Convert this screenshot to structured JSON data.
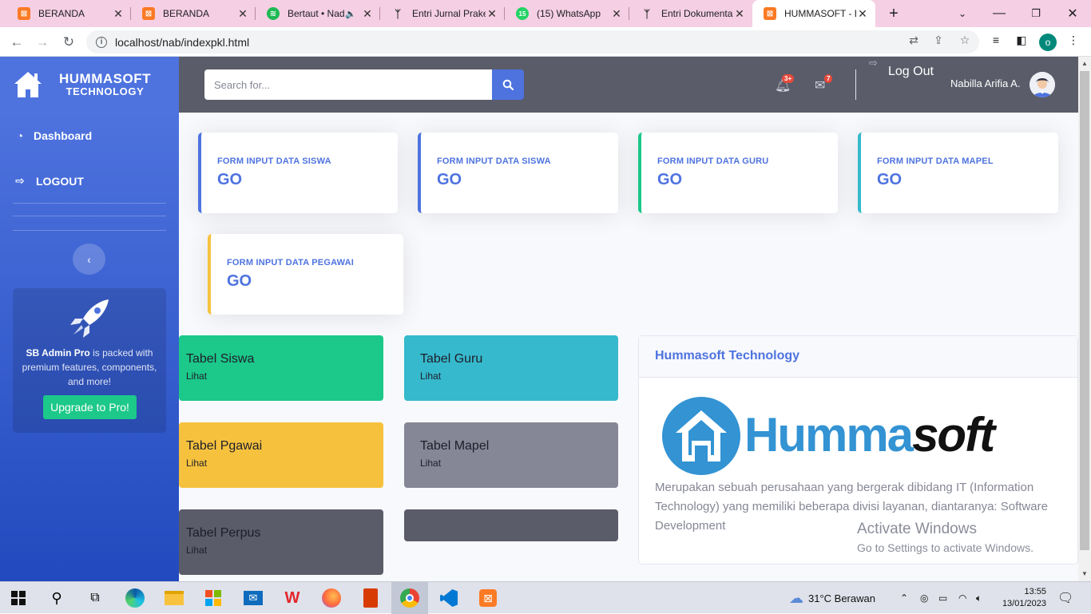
{
  "browser": {
    "tabs": [
      {
        "label": "BERANDA",
        "icon": "xampp-icon",
        "color": "#fb7a24"
      },
      {
        "label": "BERANDA",
        "icon": "xampp-icon",
        "color": "#fb7a24"
      },
      {
        "label": "Bertaut • Nad",
        "icon": "spotify-icon",
        "color": "#1db954"
      },
      {
        "label": "Entri Jurnal Prake",
        "icon": "feather-icon",
        "color": "#444"
      },
      {
        "label": "(15) WhatsApp",
        "icon": "whatsapp-icon",
        "color": "#25d366",
        "badge": "15"
      },
      {
        "label": "Entri Dokumenta",
        "icon": "feather-icon",
        "color": "#444"
      },
      {
        "label": "HUMMASOFT - D",
        "icon": "xampp-icon",
        "color": "#fb7a24"
      }
    ],
    "url": "localhost/nab/indexpkl.html",
    "profile_initial": "o"
  },
  "sidebar": {
    "brand_line1": "HUMMASOFT",
    "brand_line2": "TECHNOLOGY",
    "items": [
      {
        "label": "Dashboard",
        "icon": "tachometer-icon"
      },
      {
        "label": "LOGOUT",
        "icon": "sign-out-icon"
      }
    ],
    "promo_name": "SB Admin Pro",
    "promo_text": " is packed with premium features, components, and more!",
    "promo_button": "Upgrade to Pro!"
  },
  "topbar": {
    "search_placeholder": "Search for...",
    "alerts_badge": "3+",
    "messages_badge": "7",
    "logout_label": "Log Out",
    "username": "Nabilla Arifia A."
  },
  "cards": [
    {
      "title": "FORM INPUT DATA SISWA",
      "value": "GO",
      "accent": "#4e73df"
    },
    {
      "title": "FORM INPUT DATA SISWA",
      "value": "GO",
      "accent": "#4e73df"
    },
    {
      "title": "FORM INPUT DATA GURU",
      "value": "GO",
      "accent": "#1cc88a"
    },
    {
      "title": "FORM INPUT DATA MAPEL",
      "value": "GO",
      "accent": "#36b9cc"
    },
    {
      "title": "FORM INPUT DATA PEGAWAI",
      "value": "GO",
      "accent": "#f6c23e"
    }
  ],
  "tiles": [
    {
      "name": "Tabel Siswa",
      "sub": "Lihat",
      "color": "#1cc88a"
    },
    {
      "name": "Tabel Guru",
      "sub": "Lihat",
      "color": "#36b9cc"
    },
    {
      "name": "Tabel Pgawai",
      "sub": "Lihat",
      "color": "#f6c23e"
    },
    {
      "name": "Tabel Mapel",
      "sub": "Lihat",
      "color": "#858796"
    },
    {
      "name": "Tabel Perpus",
      "sub": "Lihat",
      "color": "#5a5c69"
    },
    {
      "name": "",
      "sub": "",
      "color": "#5a5c69"
    }
  ],
  "info": {
    "title": "Hummasoft Technology",
    "logo_text_1": "Humma",
    "logo_text_2": "soft",
    "text": "Merupakan sebuah perusahaan yang bergerak dibidang IT (Information Technology) yang memiliki beberapa divisi layanan, diantaranya: Software Development"
  },
  "watermark": {
    "line1": "Activate Windows",
    "line2": "Go to Settings to activate Windows."
  },
  "taskbar": {
    "weather": "31°C  Berawan",
    "time": "13:55",
    "date": "13/01/2023"
  }
}
